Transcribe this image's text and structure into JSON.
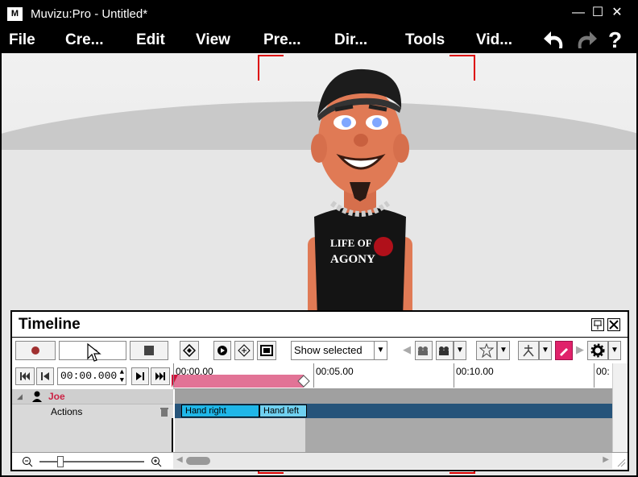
{
  "window": {
    "logo_text": "M",
    "title": "Muvizu:Pro - Untitled*",
    "minimize": "—",
    "maximize": "☐",
    "close": "✕"
  },
  "menu": {
    "items": [
      "File",
      "Cre...",
      "Edit",
      "View",
      "Pre...",
      "Dir...",
      "Tools",
      "Vid..."
    ],
    "undo_icon": "undo-icon",
    "redo_icon": "redo-icon",
    "help": "?"
  },
  "timeline": {
    "title": "Timeline",
    "pin_icon": "pin-icon",
    "close_icon": "close-icon",
    "show_selected": "Show selected",
    "time_value": "00:00.000",
    "ruler_labels": [
      "00:00.00",
      "00:05.00",
      "00:10.00",
      "00:"
    ],
    "character_name": "Joe",
    "track_label": "Actions",
    "clips": [
      "Hand right",
      "Hand left"
    ],
    "colors": {
      "character_name": "#cc2244",
      "range": "#e27396",
      "clip_active": "#1fb6e8",
      "clip_second": "#6fd0f0",
      "lane": "#26547a",
      "draw_button": "#e0226a"
    }
  }
}
